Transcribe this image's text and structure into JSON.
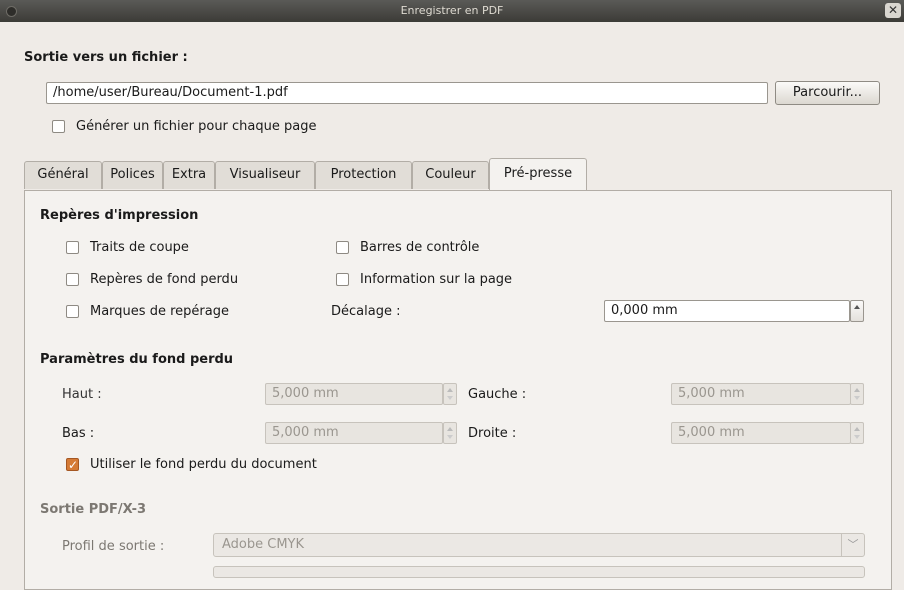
{
  "window": {
    "title": "Enregistrer en PDF",
    "close_glyph": "✕"
  },
  "output": {
    "section_label": "Sortie vers un fichier :",
    "path_value": "/home/user/Bureau/Document-1.pdf",
    "browse_label": "Parcourir...",
    "per_page_label": "Générer un fichier pour chaque page",
    "per_page_checked": false
  },
  "tabs": [
    {
      "label": "Général",
      "active": false
    },
    {
      "label": "Polices",
      "active": false
    },
    {
      "label": "Extra",
      "active": false
    },
    {
      "label": "Visualiseur",
      "active": false
    },
    {
      "label": "Protection",
      "active": false
    },
    {
      "label": "Couleur",
      "active": false
    },
    {
      "label": "Pré-presse",
      "active": true
    }
  ],
  "print_marks": {
    "section_label": "Repères d'impression",
    "crop_marks": "Traits de coupe",
    "bleed_marks": "Repères de fond perdu",
    "registration_marks": "Marques de repérage",
    "color_bars": "Barres de contrôle",
    "page_info": "Information sur la page",
    "offset_label": "Décalage :",
    "offset_value": "0,000 mm"
  },
  "bleed": {
    "section_label": "Paramètres du fond perdu",
    "top_label": "Haut :",
    "top_value": "5,000 mm",
    "bottom_label": "Bas :",
    "bottom_value": "5,000 mm",
    "left_label": "Gauche :",
    "left_value": "5,000 mm",
    "right_label": "Droite :",
    "right_value": "5,000 mm",
    "use_doc_bleed_label": "Utiliser le fond perdu du document",
    "use_doc_bleed_checked": true
  },
  "pdfx": {
    "section_label": "Sortie PDF/X-3",
    "profile_label": "Profil de sortie :",
    "profile_value": "Adobe CMYK"
  },
  "colors": {
    "accent": "#d57b36",
    "titlebar": "#3c3b37"
  }
}
